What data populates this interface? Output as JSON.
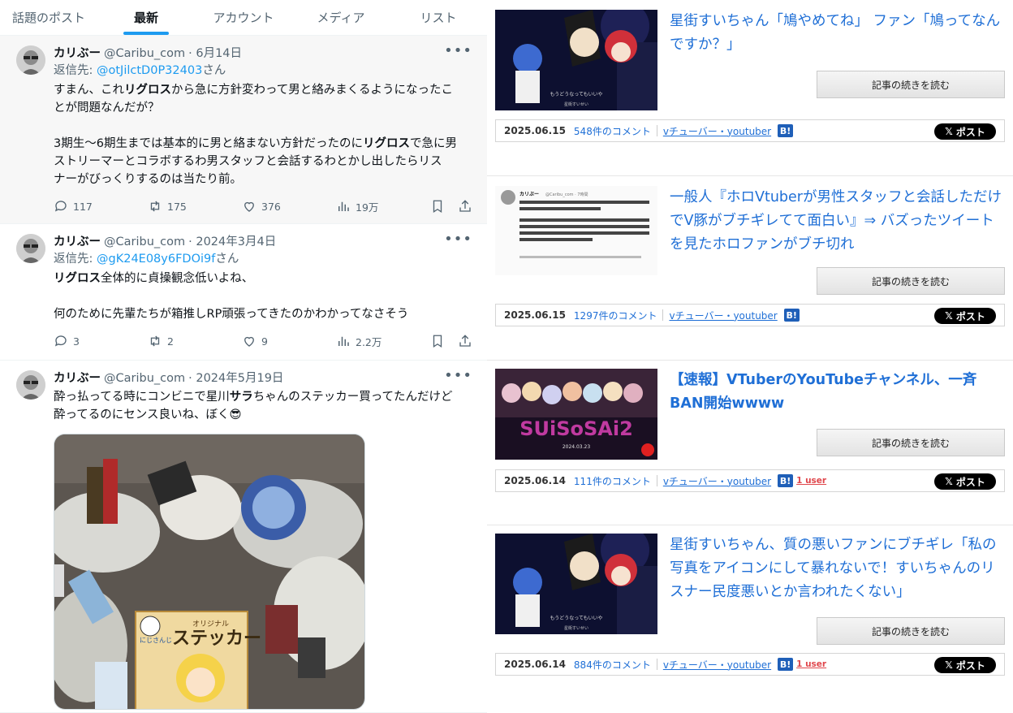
{
  "tabs": [
    "話題のポスト",
    "最新",
    "アカウント",
    "メディア",
    "リスト"
  ],
  "tweets": [
    {
      "name": "カリぶー",
      "handle": "@Caribu_com",
      "date": "· 6月14日",
      "reply_label": "返信先:",
      "reply_to": "@otJilctD0P32403",
      "reply_suffix": "さん",
      "lines": [
        [
          "すまん、これ",
          "リグロス",
          "から急に方針変わって男と絡みまくるようになったこ"
        ],
        [
          "とが問題なんだが？"
        ],
        [
          ""
        ],
        [
          "3期生〜6期生までは基本的に男と絡まない方針だったのに",
          "リグロス",
          "で急に男"
        ],
        [
          "ストリーマーとコラボするわ男スタッフと会話するわとかし出したらリス"
        ],
        [
          "ナーがびっくりするのは当たり前。"
        ]
      ],
      "replies": "117",
      "reposts": "175",
      "likes": "376",
      "views": "19万"
    },
    {
      "name": "カリぶー",
      "handle": "@Caribu_com",
      "date": "· 2024年3月4日",
      "reply_label": "返信先:",
      "reply_to": "@gK24E08y6FDOi9f",
      "reply_suffix": "さん",
      "lines": [
        [
          "リグロス",
          "全体的に貞操観念低いよね、"
        ],
        [
          ""
        ],
        [
          "何のために先輩たちが箱推しRP頑張ってきたのかわかってなさそう"
        ]
      ],
      "replies": "3",
      "reposts": "2",
      "likes": "9",
      "views": "2.2万"
    },
    {
      "name": "カリぶー",
      "handle": "@Caribu_com",
      "date": "· 2024年5月19日",
      "line1a": "酔っ払ってる時にコンビニで星川",
      "line1b": "サラ",
      "line1c": "ちゃんのステッカー買ってたんだけど",
      "line2": "酔ってるのにセンス良いね、ぼく😎",
      "sticker_brand": "にじさんじ",
      "sticker_small": "オリジナル",
      "sticker_big": "ステッカー"
    }
  ],
  "posts": [
    {
      "title": "星街すいちゃん「鳩やめてね」 ファン「鳩ってなんですか？」",
      "bold": false,
      "readmore": "記事の続きを読む",
      "date": "2025.06.15",
      "comments": "548件のコメント",
      "category": "vチューバー・youtuber",
      "users": "",
      "xpost": "ポスト",
      "thumb_text": "もうどうなってもいいや",
      "thumb_sign": "星街すいせい"
    },
    {
      "title": "一般人『ホロVtuberが男性スタッフと会話しただけでV豚がブチギレてて面白い』⇒ バズったツイートを見たホロファンがブチ切れ",
      "bold": false,
      "readmore": "記事の続きを読む",
      "date": "2025.06.15",
      "comments": "1297件のコメント",
      "category": "vチューバー・youtuber",
      "users": "",
      "xpost": "ポスト",
      "thumb_name": "カリぶー",
      "thumb_handle": "@Caribu_com · 7時間"
    },
    {
      "title": "【速報】VTuberのYouTubeチャンネル、一斉BAN開始wwww",
      "bold": true,
      "readmore": "記事の続きを読む",
      "date": "2025.06.14",
      "comments": "111件のコメント",
      "category": "vチューバー・youtuber",
      "users": "1 user",
      "xpost": "ポスト",
      "thumb_logo": "SUiSoSAi2",
      "thumb_sub": "2024.03.23"
    },
    {
      "title": "星街すいちゃん、質の悪いファンにブチギレ「私の写真をアイコンにして暴れないで！すいちゃんのリスナー民度悪いとか言われたくない」",
      "bold": false,
      "readmore": "記事の続きを読む",
      "date": "2025.06.14",
      "comments": "884件のコメント",
      "category": "vチューバー・youtuber",
      "users": "1 user",
      "xpost": "ポスト",
      "thumb_text": "もうどうなってもいいや",
      "thumb_sign": "星街すいせい"
    }
  ],
  "colors": {
    "x_blue": "#1d9bf0",
    "link_blue": "#1f6fd6",
    "hatena": "#1f5fb8",
    "users_red": "#e0474c"
  }
}
